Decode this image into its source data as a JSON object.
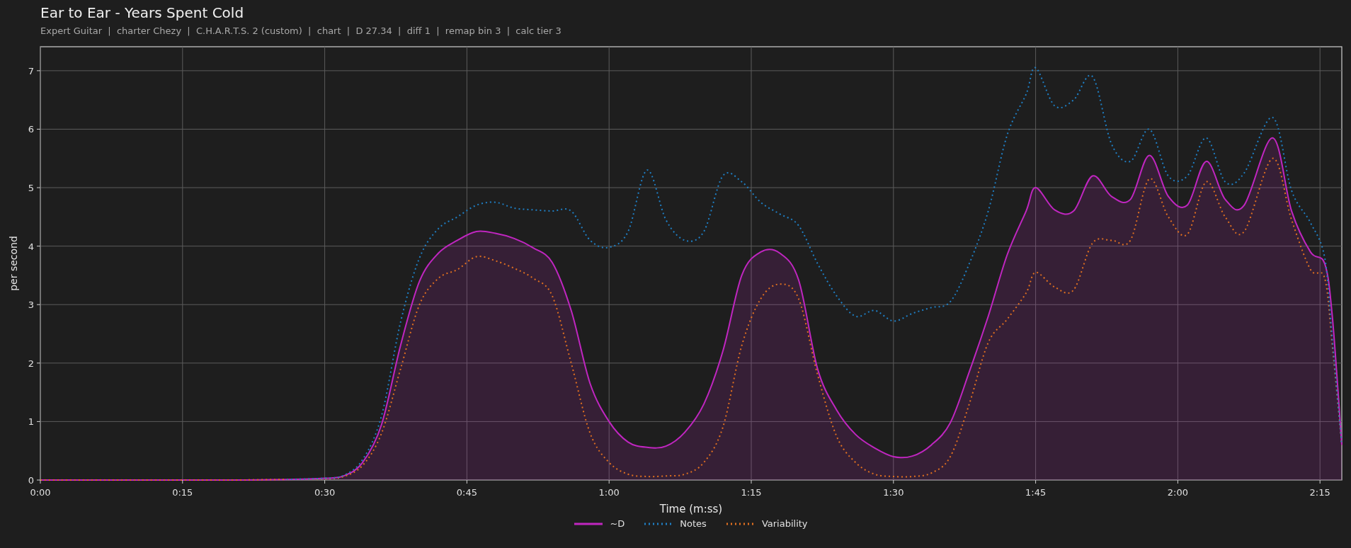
{
  "title": "Ear to Ear - Years Spent Cold",
  "subtitle": "Expert Guitar  |  charter Chezy  |  C.H.A.R.T.S. 2 (custom)  |  chart  |  D 27.34  |  diff 1  |  remap bin 3  |  calc tier 3",
  "chart": {
    "chart_data": {
      "type": "line",
      "xlabel": "Time (m:ss)",
      "ylabel": "per second",
      "x": [
        0,
        10,
        20,
        26,
        30,
        32,
        34,
        36,
        38,
        40,
        42,
        44,
        46,
        48,
        50,
        52,
        54,
        56,
        58,
        60,
        62,
        64,
        66,
        68,
        70,
        72,
        74,
        76,
        78,
        80,
        82,
        84,
        86,
        88,
        90,
        92,
        94,
        96,
        98,
        100,
        102,
        104,
        105,
        107,
        109,
        111,
        113,
        115,
        117,
        119,
        121,
        123,
        125,
        127,
        130,
        132,
        134,
        135.5,
        136.3,
        137.3
      ],
      "series": [
        {
          "name": "~D",
          "color": "#c026c0",
          "line_style": "solid",
          "values": [
            0,
            0,
            0,
            0.01,
            0.03,
            0.07,
            0.3,
            0.95,
            2.3,
            3.4,
            3.88,
            4.1,
            4.25,
            4.22,
            4.13,
            3.97,
            3.72,
            2.9,
            1.65,
            1.0,
            0.65,
            0.56,
            0.58,
            0.82,
            1.3,
            2.2,
            3.5,
            3.9,
            3.88,
            3.42,
            1.9,
            1.2,
            0.78,
            0.55,
            0.4,
            0.41,
            0.6,
            0.98,
            1.85,
            2.8,
            3.85,
            4.6,
            5.0,
            4.62,
            4.6,
            5.2,
            4.85,
            4.8,
            5.55,
            4.85,
            4.7,
            5.45,
            4.8,
            4.7,
            5.85,
            4.6,
            3.9,
            3.7,
            2.8,
            0.6
          ]
        },
        {
          "name": "Notes",
          "color": "#1f7fc4",
          "line_style": "dotted",
          "values": [
            null,
            null,
            null,
            0.01,
            0.03,
            0.08,
            0.35,
            1.1,
            2.7,
            3.8,
            4.3,
            4.5,
            4.7,
            4.75,
            4.65,
            4.62,
            4.6,
            4.6,
            4.1,
            3.98,
            4.25,
            5.3,
            4.45,
            4.1,
            4.25,
            5.2,
            5.1,
            4.75,
            4.55,
            4.35,
            3.7,
            3.15,
            2.8,
            2.9,
            2.72,
            2.85,
            2.95,
            3.05,
            3.7,
            4.6,
            5.9,
            6.6,
            7.05,
            6.4,
            6.5,
            6.9,
            5.75,
            5.45,
            6.0,
            5.2,
            5.2,
            5.85,
            5.1,
            5.25,
            6.2,
            4.95,
            4.4,
            3.8,
            2.4,
            0.6
          ]
        },
        {
          "name": "Variability",
          "color": "#e07020",
          "line_style": "dotted",
          "values": [
            0,
            0,
            0,
            0.01,
            0.02,
            0.06,
            0.25,
            0.8,
            1.9,
            3.0,
            3.45,
            3.6,
            3.82,
            3.75,
            3.62,
            3.45,
            3.15,
            2.0,
            0.8,
            0.3,
            0.1,
            0.06,
            0.07,
            0.1,
            0.3,
            0.9,
            2.3,
            3.1,
            3.35,
            3.1,
            1.8,
            0.75,
            0.3,
            0.1,
            0.06,
            0.06,
            0.12,
            0.4,
            1.3,
            2.35,
            2.75,
            3.2,
            3.55,
            3.3,
            3.25,
            4.05,
            4.1,
            4.1,
            5.15,
            4.5,
            4.2,
            5.1,
            4.5,
            4.25,
            5.5,
            4.45,
            3.6,
            3.45,
            2.3,
            0.6
          ]
        }
      ],
      "xlim": [
        0,
        137.3
      ],
      "ylim": [
        0,
        7.41
      ],
      "xticks": [
        {
          "value": 0,
          "label": "0:00"
        },
        {
          "value": 15,
          "label": "0:15"
        },
        {
          "value": 30,
          "label": "0:30"
        },
        {
          "value": 45,
          "label": "0:45"
        },
        {
          "value": 60,
          "label": "1:00"
        },
        {
          "value": 75,
          "label": "1:15"
        },
        {
          "value": 90,
          "label": "1:30"
        },
        {
          "value": 105,
          "label": "1:45"
        },
        {
          "value": 120,
          "label": "2:00"
        },
        {
          "value": 135,
          "label": "2:15"
        }
      ],
      "yticks": [
        0,
        1,
        2,
        3,
        4,
        5,
        6,
        7
      ],
      "grid": true
    }
  }
}
